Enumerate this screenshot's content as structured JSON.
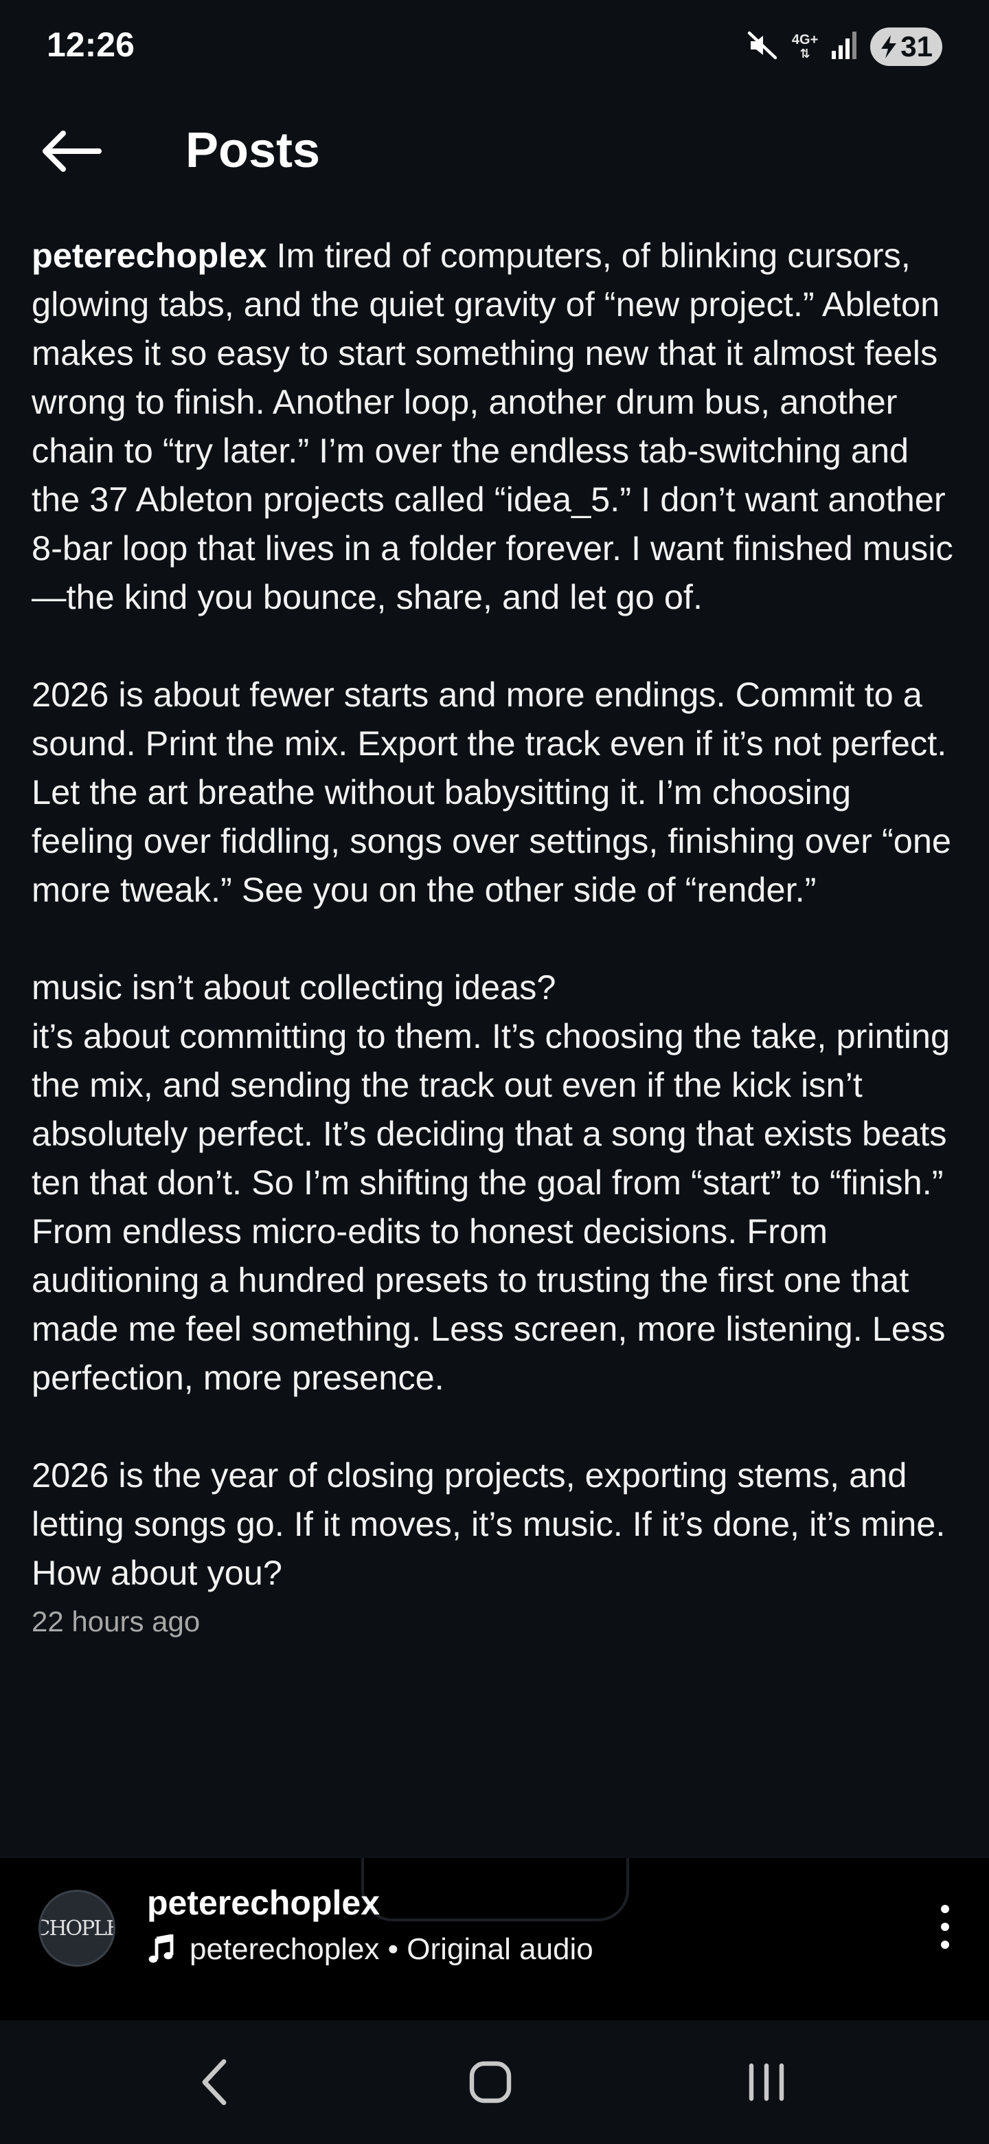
{
  "status_bar": {
    "time": "12:26",
    "network": "4G+",
    "battery": "31"
  },
  "header": {
    "title": "Posts"
  },
  "post": {
    "username": "peterechoplex",
    "paragraph_1": "Im tired of computers, of blinking cursors, glowing tabs, and the quiet gravity of “new project.” Ableton makes it so easy to start something new that it almost feels wrong to finish. Another loop, another drum bus, another chain to “try later.” I’m over the endless tab-switching and the 37 Ableton projects called “idea_5.” I don’t want another 8-bar loop that lives in a folder forever. I want finished music—the kind you bounce, share, and let go of.",
    "paragraph_2": "2026 is about fewer starts and more endings. Commit to a sound. Print the mix. Export the track even if it’s not perfect. Let the art breathe without babysitting it. I’m choosing feeling over fiddling, songs over settings, finishing over “one more tweak.” See you on the other side of “render.”",
    "paragraph_3": "music isn’t about collecting ideas?\nit’s about committing to them. It’s choosing the take, printing the mix, and sending the track out even if the kick isn’t absolutely perfect. It’s deciding that a song that exists beats ten that don’t. So I’m shifting the goal from “start” to “finish.” From endless micro-edits to honest decisions. From auditioning a hundred presets to trusting the first one that made me feel something. Less screen, more listening. Less perfection, more presence.",
    "paragraph_4": "2026 is the year of closing projects, exporting stems, and letting songs go. If it moves, it’s music. If it’s done, it’s mine. How about you?",
    "timestamp": "22 hours ago"
  },
  "audio_player": {
    "avatar_text": "ECHOPLEX",
    "account_name": "peterechoplex",
    "audio_label": "peterechoplex • Original audio"
  },
  "icons": {
    "back": "arrow-left-icon",
    "mute": "mute-icon",
    "signal": "signal-icon",
    "music": "music-note-icon",
    "more": "more-vertical-icon",
    "nav_back": "chevron-left-icon",
    "nav_home": "home-icon",
    "nav_recents": "recents-icon"
  },
  "colors": {
    "background": "#0c1014",
    "player_background": "#000000",
    "secondary_text": "#a8a8a8"
  }
}
